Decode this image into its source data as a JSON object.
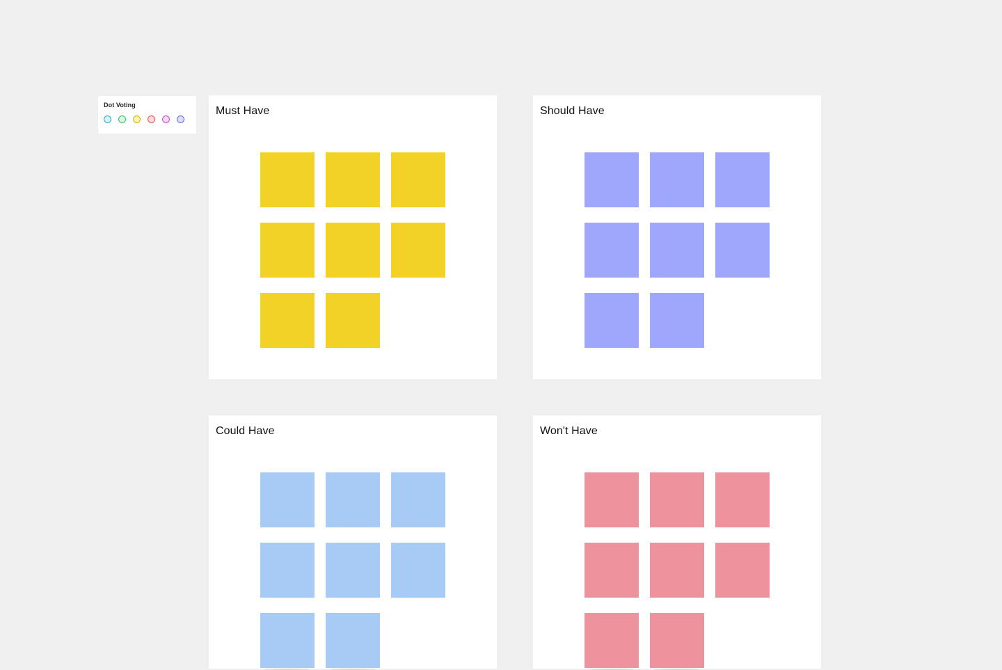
{
  "dot_voting": {
    "title": "Dot Voting",
    "dots": [
      {
        "name": "cyan",
        "border": "#2aa9c2",
        "fill": "#d6f4f8"
      },
      {
        "name": "green",
        "border": "#3dbb6f",
        "fill": "#d9f6e3"
      },
      {
        "name": "yellow",
        "border": "#d6b100",
        "fill": "#fbf2b8"
      },
      {
        "name": "red",
        "border": "#d65c5c",
        "fill": "#fbd9d9"
      },
      {
        "name": "pink",
        "border": "#c24fd0",
        "fill": "#f5d6f7"
      },
      {
        "name": "violet",
        "border": "#6b6bd6",
        "fill": "#dcdcfb"
      }
    ]
  },
  "frames": [
    {
      "id": "must",
      "title": "Must Have",
      "sticky_color": "#f3d227",
      "sticky_count": 8
    },
    {
      "id": "should",
      "title": "Should Have",
      "sticky_color": "#9ea7fb",
      "sticky_count": 8
    },
    {
      "id": "could",
      "title": "Could Have",
      "sticky_color": "#a8cbf5",
      "sticky_count": 8
    },
    {
      "id": "wont",
      "title": "Won't Have",
      "sticky_color": "#ee939d",
      "sticky_count": 8
    }
  ]
}
